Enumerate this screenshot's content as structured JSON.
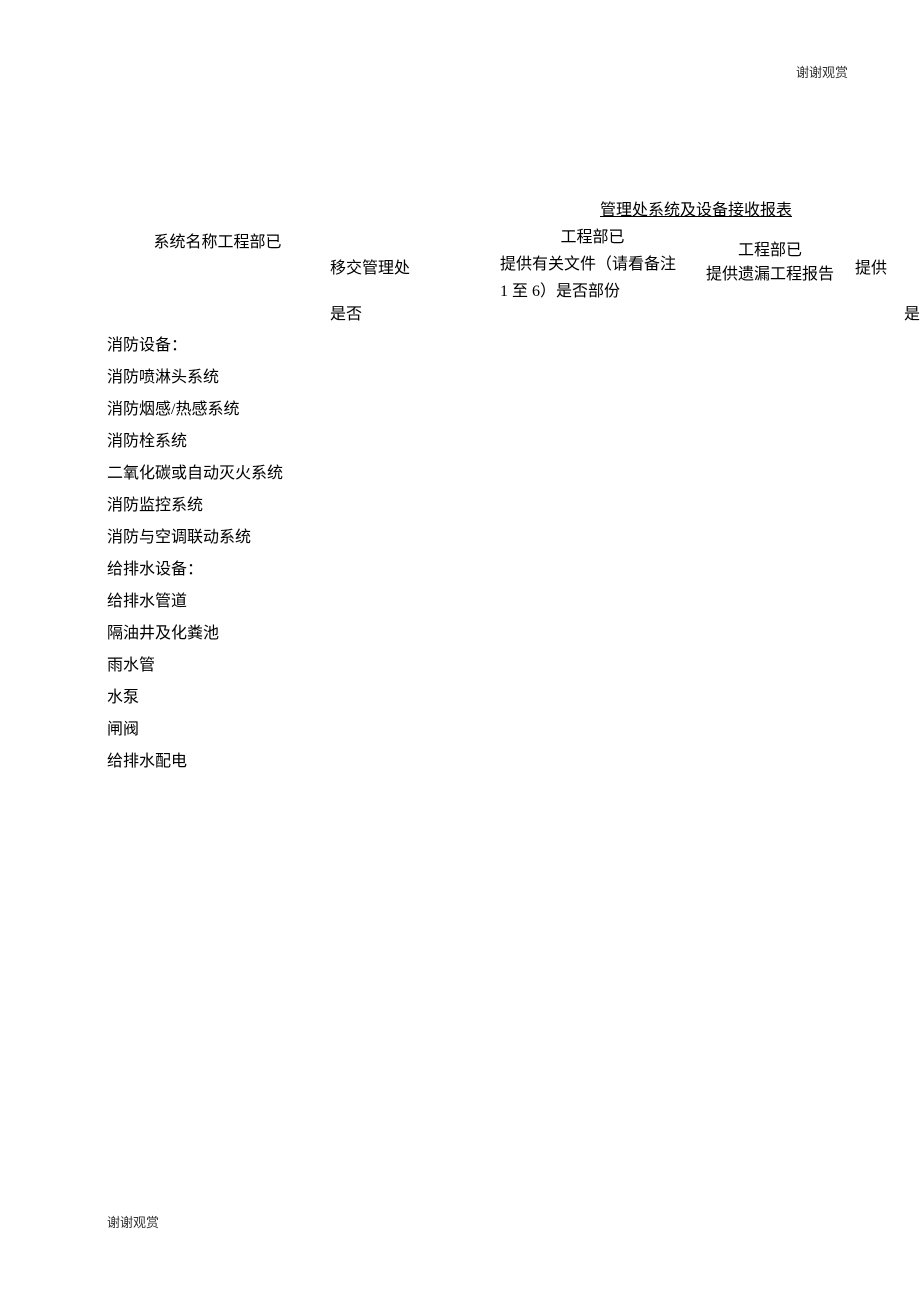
{
  "header_note": "谢谢观赏",
  "footer_note": "谢谢观赏",
  "title": "管理处系统及设备接收报表",
  "columns": {
    "col1": "系统名称工程部已",
    "col2_line1": "移交管理处",
    "col2_line2": "是否",
    "col3_line1": "工程部已",
    "col3_line2": "提供有关文件（请看备注 1 至 6）是否部份",
    "col4_line1": "工程部已",
    "col4_line2": "提供遗漏工程报告",
    "col5_line1": "提供",
    "col5_line2": "是"
  },
  "items": [
    "消防设备：",
    "消防喷淋头系统",
    "消防烟感/热感系统",
    "消防栓系统",
    "二氧化碳或自动灭火系统",
    "消防监控系统",
    "消防与空调联动系统",
    "给排水设备：",
    "给排水管道",
    "隔油井及化粪池",
    "雨水管",
    "水泵",
    "闸阀",
    "给排水配电"
  ]
}
